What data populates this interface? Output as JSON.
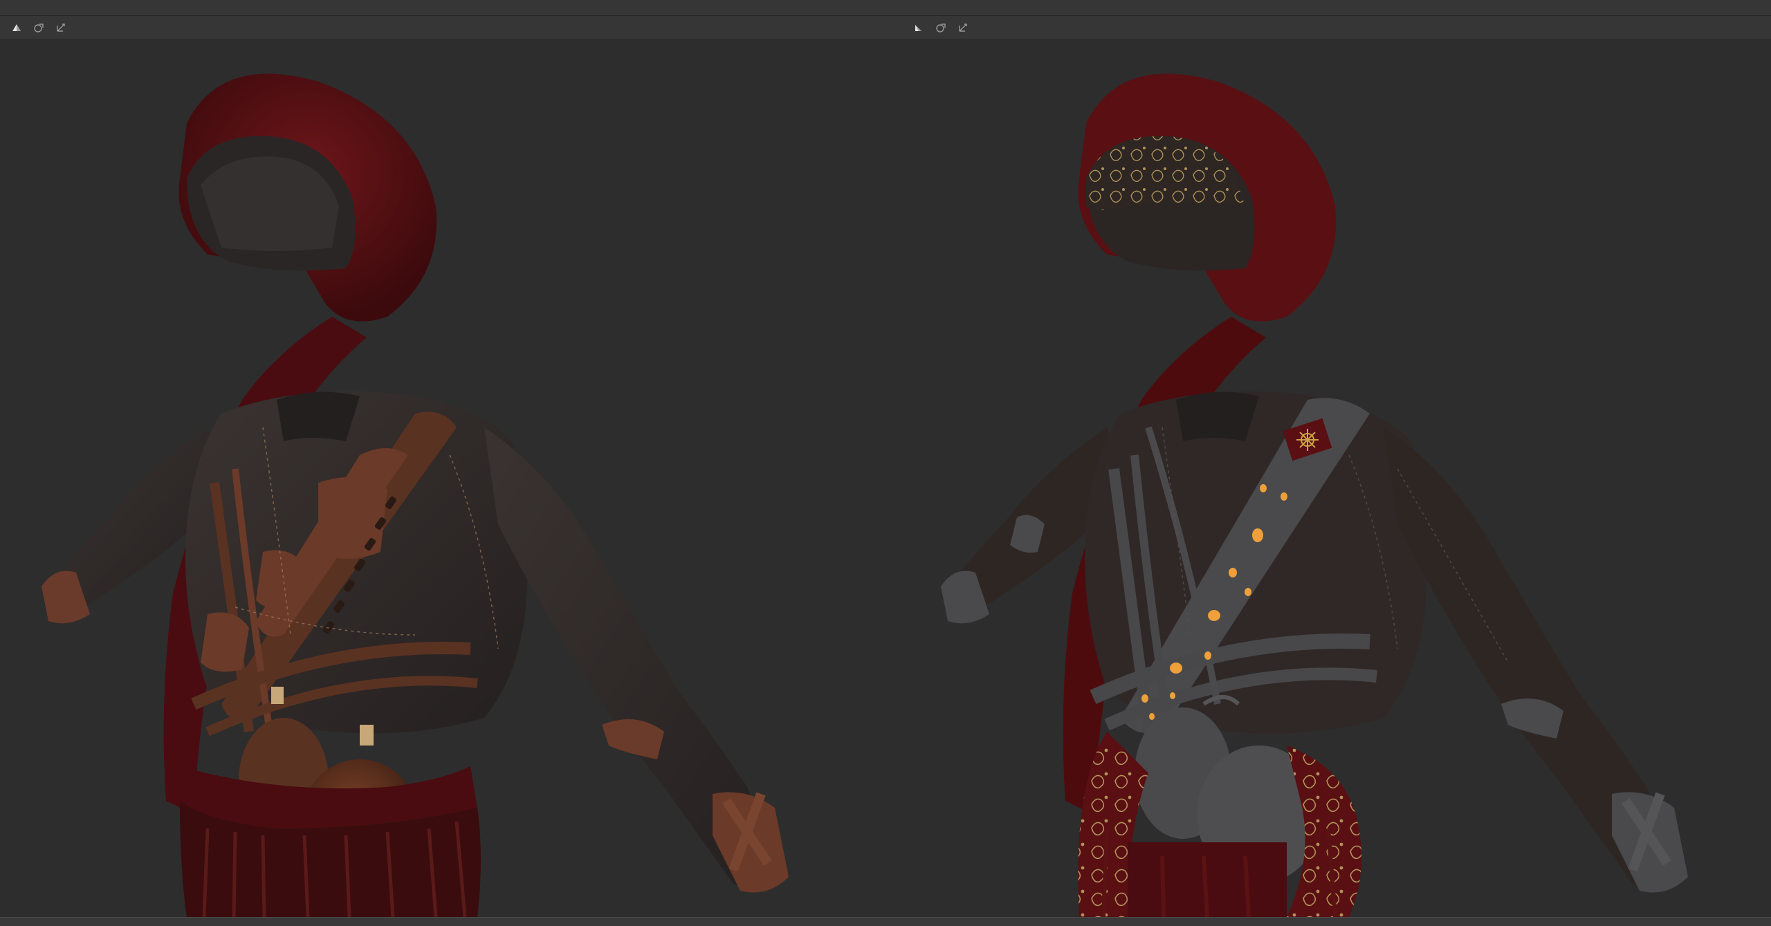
{
  "toolbar_left": {
    "icons": [
      "shading-mode-icon",
      "material-sphere-icon",
      "camera-move-icon"
    ]
  },
  "toolbar_right": {
    "icons": [
      "shading-mode-icon",
      "material-sphere-icon",
      "camera-move-icon"
    ]
  },
  "viewport_left": {
    "mode": "rendered",
    "subject": "costume-model"
  },
  "viewport_right": {
    "mode": "material-id",
    "subject": "costume-model"
  },
  "colors": {
    "background": "#2d2d2d",
    "toolbar": "#363636",
    "scarf_red": "#5a0f12",
    "leather_brown": "#5a3222",
    "jacket_dark": "#2f2826",
    "strap_gray": "#4a4a4c",
    "highlight_orange": "#f0a03a",
    "gold_pattern": "#b0935a"
  }
}
